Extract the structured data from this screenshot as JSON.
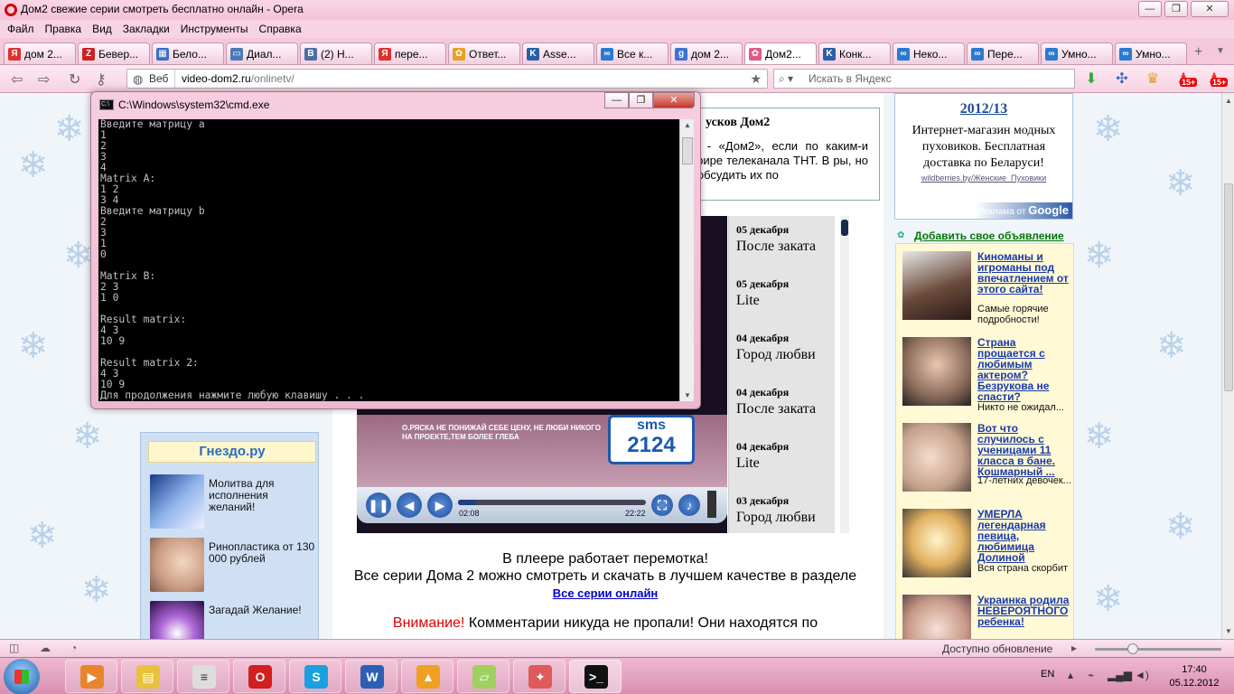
{
  "window": {
    "title": "Дом2 свежие серии смотреть бесплатно онлайн - Opera"
  },
  "menu": [
    "Файл",
    "Правка",
    "Вид",
    "Закладки",
    "Инструменты",
    "Справка"
  ],
  "tabs": [
    {
      "label": "дом 2...",
      "color": "#e03030",
      "glyph": "Я"
    },
    {
      "label": "Бевер...",
      "color": "#c22",
      "glyph": "Z"
    },
    {
      "label": "Бело...",
      "color": "#3a6fc4",
      "glyph": "▦"
    },
    {
      "label": "Диал...",
      "color": "#4a7ab5",
      "glyph": "▭"
    },
    {
      "label": "(2) Н...",
      "color": "#4a6fa5",
      "glyph": "В"
    },
    {
      "label": "пере...",
      "color": "#e03030",
      "glyph": "Я"
    },
    {
      "label": "Ответ...",
      "color": "#e8a020",
      "glyph": "✿"
    },
    {
      "label": "Asse...",
      "color": "#2a5fa8",
      "glyph": "K"
    },
    {
      "label": "Все к...",
      "color": "#2a7ad0",
      "glyph": "∞"
    },
    {
      "label": "дом 2...",
      "color": "#3b73d8",
      "glyph": "g"
    },
    {
      "label": "Дом2...",
      "color": "#e05a8a",
      "glyph": "✿"
    },
    {
      "label": "Конк...",
      "color": "#2a5fa8",
      "glyph": "K"
    },
    {
      "label": "Неко...",
      "color": "#2a7ad0",
      "glyph": "∞"
    },
    {
      "label": "Пере...",
      "color": "#2a7ad0",
      "glyph": "∞"
    },
    {
      "label": "Умно...",
      "color": "#2a7ad0",
      "glyph": "∞"
    },
    {
      "label": "Умно...",
      "color": "#2a7ad0",
      "glyph": "∞"
    }
  ],
  "navbar": {
    "web_label": "Веб",
    "url_host": "video-dom2.ru",
    "url_path": "/onlinetv/",
    "search_placeholder": "Искать в Яндекс",
    "badge1": "15+",
    "badge2": "15+"
  },
  "cmd": {
    "title": "C:\\Windows\\system32\\cmd.exe",
    "lines": [
      "Введите матрицу a",
      "1",
      "2",
      "3",
      "4",
      "Matrix A:",
      "1 2",
      "3 4",
      "Введите матрицу b",
      "2",
      "3",
      "1",
      "0",
      "",
      "Matrix B:",
      "2 3",
      "1 0",
      "",
      "Result matrix:",
      "4 3",
      "10 9",
      "",
      "Result matrix 2:",
      "4 3",
      "10 9",
      "Для продолжения нажмите любую клавишу . . ."
    ]
  },
  "description": {
    "heading": "усков Дом2",
    "text": "ти - «Дом2», если по каким-и эфире телеканала ТНТ. В ры, но и обсудить их по"
  },
  "player": {
    "video_caption": "О.РЯСКА НЕ ПОНИЖАЙ СЕБЕ ЦЕНУ, НЕ ЛЮБИ НИКОГО НА ПРОЕКТЕ,ТЕМ БОЛЕЕ ГЛЕБА",
    "sms_label": "sms",
    "sms_number": "2124",
    "time_current": "02:08",
    "time_total": "22:22",
    "progress_fraction": 0.096
  },
  "episodes": [
    {
      "date": "05 декабря",
      "name": "После заката"
    },
    {
      "date": "05 декабря",
      "name": "Lite"
    },
    {
      "date": "04 декабря",
      "name": "Город любви"
    },
    {
      "date": "04 декабря",
      "name": "После заката"
    },
    {
      "date": "04 декабря",
      "name": "Lite"
    },
    {
      "date": "03 декабря",
      "name": "Город любви"
    }
  ],
  "below_player": {
    "line1": "В плеере работает перемотка!",
    "line2": "Все серии Дома 2 можно смотреть и скачать в лучшем качестве в разделе",
    "link": "Все серии онлайн"
  },
  "notice": {
    "warn": "Внимание!",
    "text": "Комментарии никуда не пропали! Они находятся по"
  },
  "left_ads": {
    "header": "Гнездо.ру",
    "items": [
      {
        "text": "Молитва для исполнения желаний!"
      },
      {
        "text": "Ринопластика от 130 000 рублей"
      },
      {
        "text": "Загадай Желание!"
      }
    ]
  },
  "right_top": {
    "year": "2012/13",
    "body": "Интернет-магазин модных пуховиков. Бесплатная доставка по Беларуси!",
    "source": "wildberries.by/Женские_Пуховики",
    "google_prefix": "Реклама от",
    "google": "Google"
  },
  "add_ad": "Добавить свое объявление",
  "right_ads": [
    {
      "headline": "Киноманы и игроманы под впечатлением от этого сайта!",
      "sub": "Самые горячие подробности!"
    },
    {
      "headline": "Страна прощается с любимым актером? Безрукова не спасти?",
      "sub": "Никто не ожидал..."
    },
    {
      "headline": "Вот что случилось с ученицами 11 класса в бане. Кошмарный ...",
      "sub": "17-летних девочек..."
    },
    {
      "headline": "УМЕРЛА легендарная певица, любимица Долиной",
      "sub": "Вся страна скорбит"
    },
    {
      "headline": "Украинка родила НЕВЕРОЯТНОГО ребенка!",
      "sub": ""
    }
  ],
  "statusbar": {
    "update": "Доступно обновление"
  },
  "taskbar": {
    "apps": [
      {
        "name": "media-player",
        "color": "#e8852a",
        "glyph": "▶"
      },
      {
        "name": "explorer",
        "color": "#e8c23a",
        "glyph": "▤"
      },
      {
        "name": "notepad",
        "color": "#dddddd",
        "glyph": "≡"
      },
      {
        "name": "opera",
        "color": "#d21f1f",
        "glyph": "O"
      },
      {
        "name": "skype",
        "color": "#1aa0e0",
        "glyph": "S"
      },
      {
        "name": "word",
        "color": "#2a5fb5",
        "glyph": "W"
      },
      {
        "name": "aimp",
        "color": "#f0a020",
        "glyph": "▲"
      },
      {
        "name": "notes",
        "color": "#9fd060",
        "glyph": "▱"
      },
      {
        "name": "app",
        "color": "#e05a5a",
        "glyph": "✦"
      },
      {
        "name": "cmd",
        "color": "#111111",
        "glyph": ">_"
      }
    ],
    "lang": "EN",
    "time": "17:40",
    "date": "05.12.2012"
  }
}
